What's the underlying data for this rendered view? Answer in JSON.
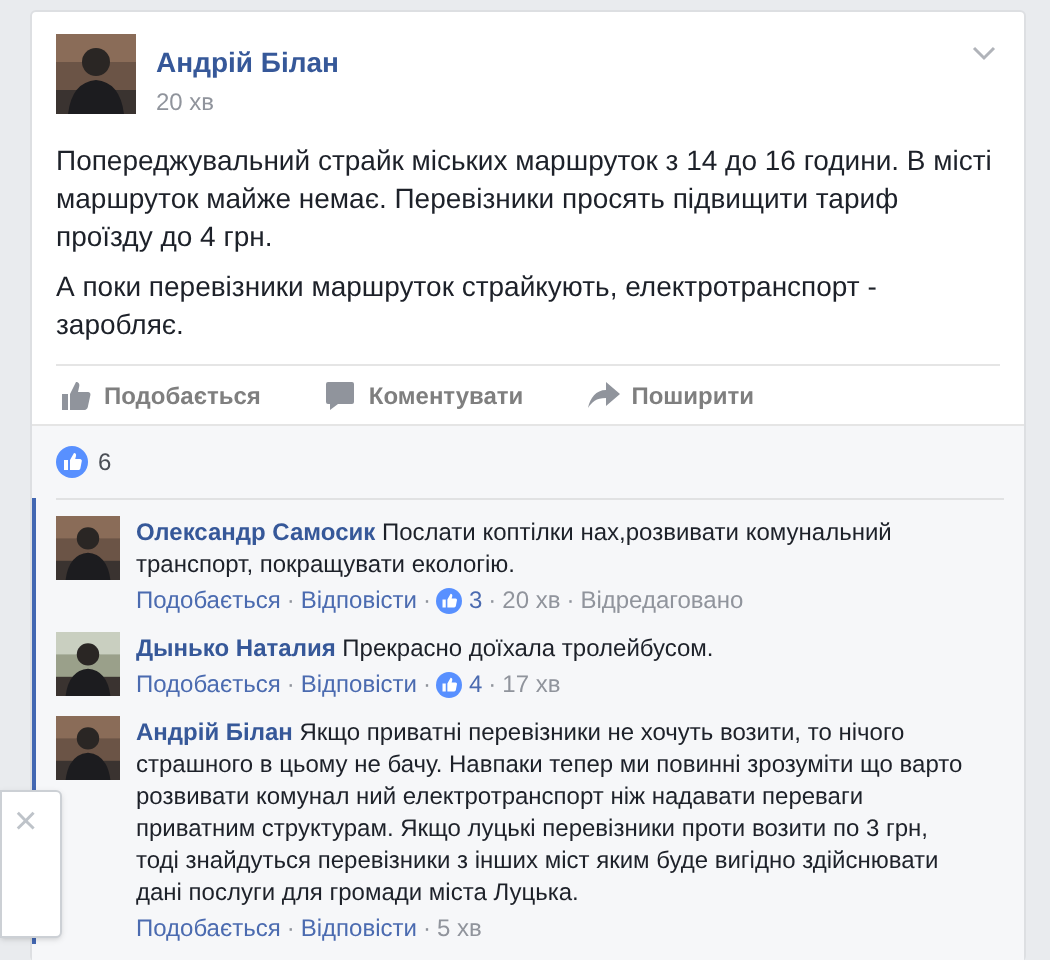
{
  "post": {
    "author": "Андрій Білан",
    "time": "20 хв",
    "paragraphs": [
      "Попереджувальний страйк міських маршруток з 14 до 16 години. В місті маршруток майже немає. Перевізники просять підвищити тариф проїзду до 4 грн.",
      "А поки перевізники маршруток страйкують, електротранспорт - заробляє."
    ],
    "actions": [
      {
        "kind": "like",
        "label": "Подобається"
      },
      {
        "kind": "comment",
        "label": "Коментувати"
      },
      {
        "kind": "share",
        "label": "Поширити"
      }
    ]
  },
  "likes_count": "6",
  "comments": [
    {
      "author": "Олександр Самосик",
      "text": "Послати коптілки нах,розвивати комунальний транспорт, покращувати екологію.",
      "like_label": "Подобається",
      "separator": "·",
      "reply_label": "Відповісти",
      "likes": "3",
      "time": "20 хв",
      "edited": "Відредаговано"
    },
    {
      "author": "Дынько Наталия",
      "text": "Прекрасно доїхала тролейбусом.",
      "like_label": "Подобається",
      "separator": "·",
      "reply_label": "Відповісти",
      "likes": "4",
      "time": "17 хв"
    },
    {
      "author": "Андрій Білан",
      "text": "Якщо приватні перевізники не хочуть возити, то нічого страшного в цьому не бачу. Навпаки тепер ми повинні зрозуміти що варто розвивати комунал ний електротранспорт ніж надавати переваги приватним структурам. Якщо луцькі перевізники проти возити по 3 грн, тоді знайдуться перевізники з інших міст яким буде вигідно здійснювати дані послуги для громади міста Луцька.",
      "like_label": "Подобається",
      "separator": "·",
      "reply_label": "Відповісти",
      "time": "5 хв"
    }
  ],
  "popup": {
    "close": "×"
  }
}
